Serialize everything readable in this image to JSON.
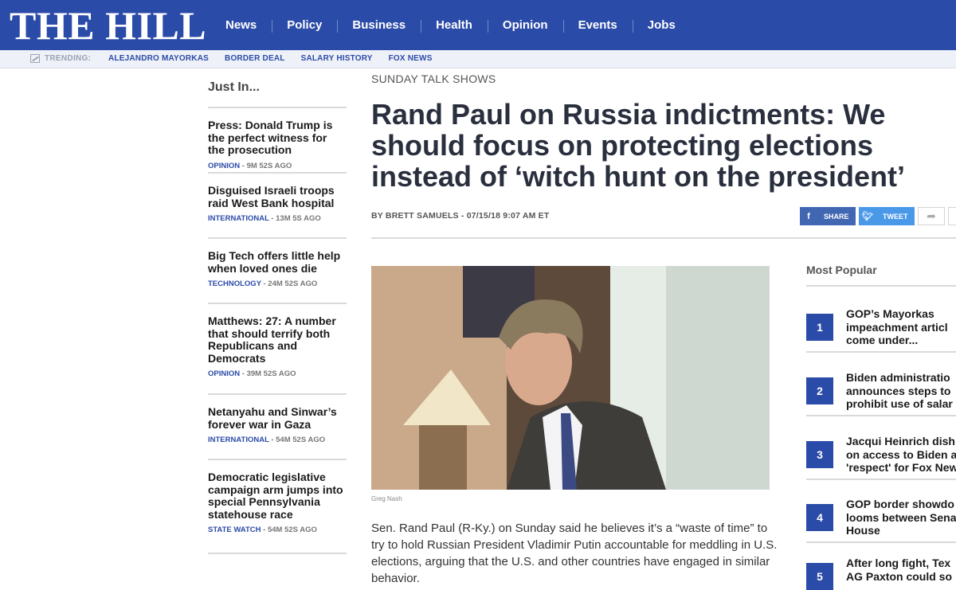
{
  "header": {
    "logo": "THE HILL",
    "nav": [
      "News",
      "Policy",
      "Business",
      "Health",
      "Opinion",
      "Events",
      "Jobs"
    ]
  },
  "trending": {
    "label": "TRENDING:",
    "links": [
      "ALEJANDRO MAYORKAS",
      "BORDER DEAL",
      "SALARY HISTORY",
      "FOX NEWS"
    ]
  },
  "just_in": {
    "heading": "Just In...",
    "items": [
      {
        "title": "Press: Donald Trump is the perfect witness for the prosecution",
        "category": "OPINION",
        "time": " - 9M 52S AGO"
      },
      {
        "title": "Disguised Israeli troops raid West Bank hospital",
        "category": "INTERNATIONAL",
        "time": " - 13M 5S AGO"
      },
      {
        "title": "Big Tech offers little help when loved ones die",
        "category": "TECHNOLOGY",
        "time": " - 24M 52S AGO"
      },
      {
        "title": "Matthews: 27: A number that should terrify both Republicans and Democrats",
        "category": "OPINION",
        "time": " - 39M 52S AGO"
      },
      {
        "title": "Netanyahu and Sinwar’s forever war in Gaza",
        "category": "INTERNATIONAL",
        "time": " - 54M 52S AGO"
      },
      {
        "title": "Democratic legislative campaign arm jumps into special Pennsylvania statehouse race",
        "category": "STATE WATCH",
        "time": " - 54M 52S AGO"
      }
    ]
  },
  "article": {
    "kicker": "SUNDAY TALK SHOWS",
    "headline_lines": [
      "Rand Paul on Russia indictments: We",
      "should focus on protecting elections",
      "instead of ‘witch hunt on the president’"
    ],
    "byline": "BY BRETT SAMUELS - 07/15/18 9:07 AM ET",
    "share_facebook": "SHARE",
    "share_twitter": "TWEET",
    "photo_credit": "Greg Nash",
    "body": "Sen. Rand Paul (R-Ky.) on Sunday said he believes it’s a “waste of time” to try to hold Russian President Vladimir Putin accountable for meddling in U.S. elections, arguing that the U.S. and other countries have engaged in similar behavior."
  },
  "most_popular": {
    "heading": "Most Popular",
    "items": [
      {
        "rank": "1",
        "title": "GOP’s Mayorkas\nimpeachment articl\ncome under..."
      },
      {
        "rank": "2",
        "title": "Biden administratio\nannounces steps to\nprohibit use of salar"
      },
      {
        "rank": "3",
        "title": "Jacqui Heinrich dish\non access to Biden a\n'respect' for Fox New"
      },
      {
        "rank": "4",
        "title": "GOP border showdo\nlooms between Sena\nHouse"
      },
      {
        "rank": "5",
        "title": "After long fight, Tex\nAG Paxton could so"
      }
    ]
  },
  "colors": {
    "brand": "#2b4ba8",
    "facebook": "#4267b2",
    "twitter": "#4a99e9"
  }
}
